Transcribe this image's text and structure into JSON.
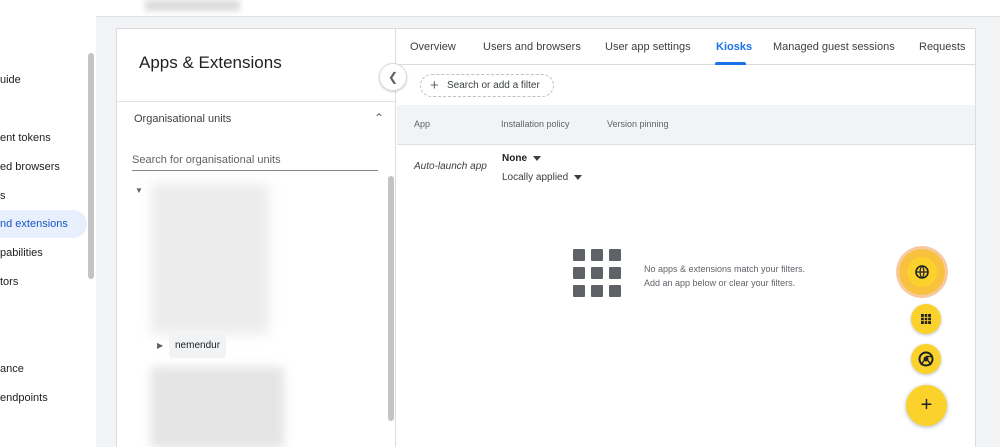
{
  "sidebar": {
    "items": [
      {
        "label": "uide",
        "top": 0
      },
      {
        "label": "ent tokens"
      },
      {
        "label": "ed browsers"
      },
      {
        "label": "s"
      },
      {
        "label": "nd extensions"
      },
      {
        "label": "pabilities"
      },
      {
        "label": "tors"
      },
      {
        "label": "ance"
      },
      {
        "label": "endpoints"
      }
    ]
  },
  "panel": {
    "title": "Apps & Extensions",
    "ou_title": "Organisational units",
    "ou_search_placeholder": "Search for organisational units",
    "tree_node": "nemendur"
  },
  "tabs": [
    {
      "label": "Overview"
    },
    {
      "label": "Users and browsers"
    },
    {
      "label": "User app settings"
    },
    {
      "label": "Kiosks"
    },
    {
      "label": "Managed guest sessions"
    },
    {
      "label": "Requests"
    }
  ],
  "filter": {
    "label": "Search or add a filter"
  },
  "table": {
    "headers": [
      "App",
      "Installation policy",
      "Version pinning"
    ],
    "row": {
      "app": "Auto-launch app",
      "policy": "None",
      "applied": "Locally applied"
    }
  },
  "empty_state": {
    "line1": "No apps & extensions match your filters.",
    "line2": "Add an app below or clear your filters."
  },
  "colors": {
    "accent": "#1a73e8",
    "fab": "#fbd22b"
  },
  "icons": {
    "collapse": "chevron-left-icon",
    "web": "globe-icon",
    "apps": "apps-grid-icon",
    "chrome": "chrome-icon",
    "add": "plus-icon"
  }
}
